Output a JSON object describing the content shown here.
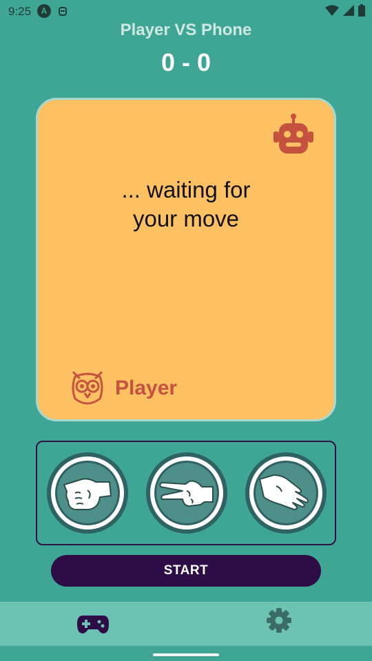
{
  "status_bar": {
    "time": "9:25",
    "left_icons": [
      "a-badge-icon",
      "debug-icon"
    ],
    "right_icons": [
      "wifi-icon",
      "cellular-icon",
      "battery-icon"
    ]
  },
  "header": {
    "title": "Player VS Phone",
    "score": "0 - 0"
  },
  "card": {
    "phone_icon": "robot-icon",
    "message": "... waiting for\nyour move",
    "player_icon": "owl-icon",
    "player_label": "Player"
  },
  "moves": [
    {
      "name": "rock",
      "icon": "rock-fist-icon"
    },
    {
      "name": "scissors",
      "icon": "scissors-hand-icon"
    },
    {
      "name": "paper",
      "icon": "paper-hand-icon"
    }
  ],
  "start_button": {
    "label": "START"
  },
  "bottom_nav": {
    "items": [
      {
        "name": "game",
        "icon": "gamepad-icon",
        "selected": true
      },
      {
        "name": "settings",
        "icon": "gear-icon",
        "selected": false
      }
    ]
  },
  "colors": {
    "background": "#3fa595",
    "card": "#fdc062",
    "accent_red": "#c4523e",
    "button_dark": "#2e0c46",
    "nav_bar": "#6cc2b3"
  }
}
